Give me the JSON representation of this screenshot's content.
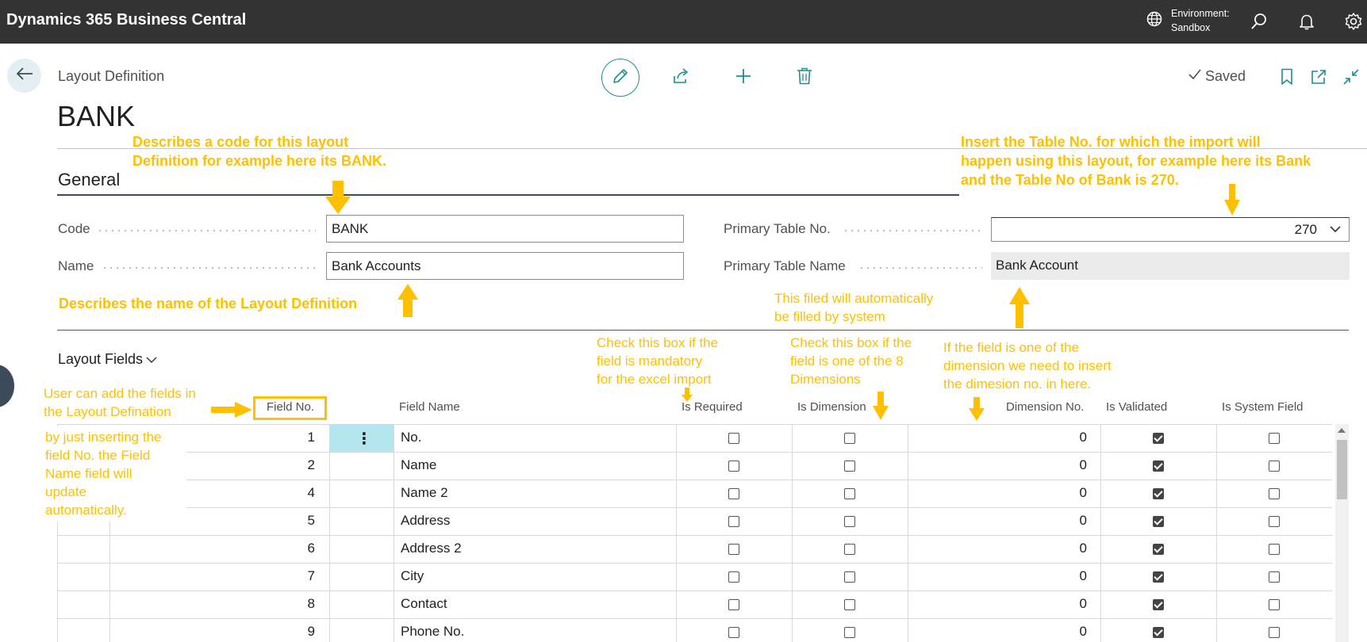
{
  "topbar": {
    "app_title": "Dynamics 365 Business Central",
    "env_label": "Environment:",
    "env_value": "Sandbox",
    "icons": [
      "globe-icon",
      "search-icon",
      "bell-icon",
      "gear-icon"
    ]
  },
  "header": {
    "caption": "Layout Definition",
    "title": "BANK",
    "saved_label": "Saved",
    "actions": [
      "edit-icon",
      "share-icon",
      "add-icon",
      "delete-icon"
    ]
  },
  "general": {
    "title": "General",
    "code_label": "Code",
    "code_value": "BANK",
    "name_label": "Name",
    "name_value": "Bank Accounts",
    "primary_table_no_label": "Primary Table No.",
    "primary_table_no_value": "270",
    "primary_table_name_label": "Primary Table Name",
    "primary_table_name_value": "Bank Account"
  },
  "layout_fields": {
    "title": "Layout Fields",
    "columns": {
      "field_no": "Field No.",
      "field_name": "Field Name",
      "is_required": "Is Required",
      "is_dimension": "Is Dimension",
      "dimension_no": "Dimension No.",
      "is_validated": "Is Validated",
      "is_system_field": "Is System Field"
    },
    "rows": [
      {
        "field_no": "1",
        "field_name": "No.",
        "is_required": false,
        "is_dimension": false,
        "dimension_no": "0",
        "is_validated": true,
        "is_system_field": false
      },
      {
        "field_no": "2",
        "field_name": "Name",
        "is_required": false,
        "is_dimension": false,
        "dimension_no": "0",
        "is_validated": true,
        "is_system_field": false
      },
      {
        "field_no": "4",
        "field_name": "Name 2",
        "is_required": false,
        "is_dimension": false,
        "dimension_no": "0",
        "is_validated": true,
        "is_system_field": false
      },
      {
        "field_no": "5",
        "field_name": "Address",
        "is_required": false,
        "is_dimension": false,
        "dimension_no": "0",
        "is_validated": true,
        "is_system_field": false
      },
      {
        "field_no": "6",
        "field_name": "Address 2",
        "is_required": false,
        "is_dimension": false,
        "dimension_no": "0",
        "is_validated": true,
        "is_system_field": false
      },
      {
        "field_no": "7",
        "field_name": "City",
        "is_required": false,
        "is_dimension": false,
        "dimension_no": "0",
        "is_validated": true,
        "is_system_field": false
      },
      {
        "field_no": "8",
        "field_name": "Contact",
        "is_required": false,
        "is_dimension": false,
        "dimension_no": "0",
        "is_validated": true,
        "is_system_field": false
      },
      {
        "field_no": "9",
        "field_name": "Phone No.",
        "is_required": false,
        "is_dimension": false,
        "dimension_no": "0",
        "is_validated": true,
        "is_system_field": false
      }
    ]
  },
  "annotations": {
    "code_note_1": "Describes a code for this layout",
    "code_note_2": "Definition for example here its BANK.",
    "table_note_1": "Insert the Table No. for which the import will",
    "table_note_2": "happen using this layout, for example here its Bank",
    "table_note_3": "and the Table No of Bank is 270.",
    "name_note": "Describes the name of the Layout Definition",
    "auto_note_1": "This filed will automatically",
    "auto_note_2": "be filled by system",
    "required_note_1": "Check this box if the",
    "required_note_2": "field is mandatory",
    "required_note_3": "for the excel import",
    "dimension_note_1": "Check this box if the",
    "dimension_note_2": "field is one of the 8",
    "dimension_note_3": "Dimensions",
    "dimno_note_1": "If the field is one of the",
    "dimno_note_2": "dimension we need to insert",
    "dimno_note_3": "the dimesion no. in here.",
    "user_note_1": "User can add the fields in",
    "user_note_2": "the Layout Defination",
    "insert_note_1": "by just inserting the",
    "insert_note_2": "field No. the Field",
    "insert_note_3": "Name field will",
    "insert_note_4": "update",
    "insert_note_5": "automatically.",
    "color": "#ffc000"
  }
}
